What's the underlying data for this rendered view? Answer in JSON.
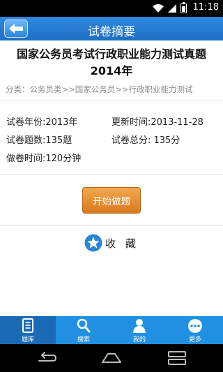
{
  "status_bar": {
    "time": "11:18"
  },
  "header": {
    "back_label": "",
    "title": "试卷摘要"
  },
  "paper": {
    "title": "国家公务员考试行政职业能力测试真题2014年",
    "category": "分类：公务员类>>国家公务员>>行政职业能力测试"
  },
  "info": {
    "year": "试卷年份:2013年",
    "updated": "更新时间:2013-11-28",
    "question_count": "试卷题数:135题",
    "total_score": "试卷总分: 135分",
    "duration": "做卷时间:120分钟"
  },
  "actions": {
    "start_label": "开始做题",
    "favorite_label": "收藏"
  },
  "bottom_nav": {
    "items": [
      {
        "label": "题库",
        "icon": "book-icon",
        "active": true
      },
      {
        "label": "搜索",
        "icon": "search-icon",
        "active": false
      },
      {
        "label": "我的",
        "icon": "user-icon",
        "active": false
      },
      {
        "label": "更多",
        "icon": "more-icon",
        "active": false
      }
    ]
  },
  "colors": {
    "header": "#1d6fc3",
    "nav": "#2290e2",
    "nav_active": "#1a6ab5",
    "start_button": "#e38a2f"
  }
}
